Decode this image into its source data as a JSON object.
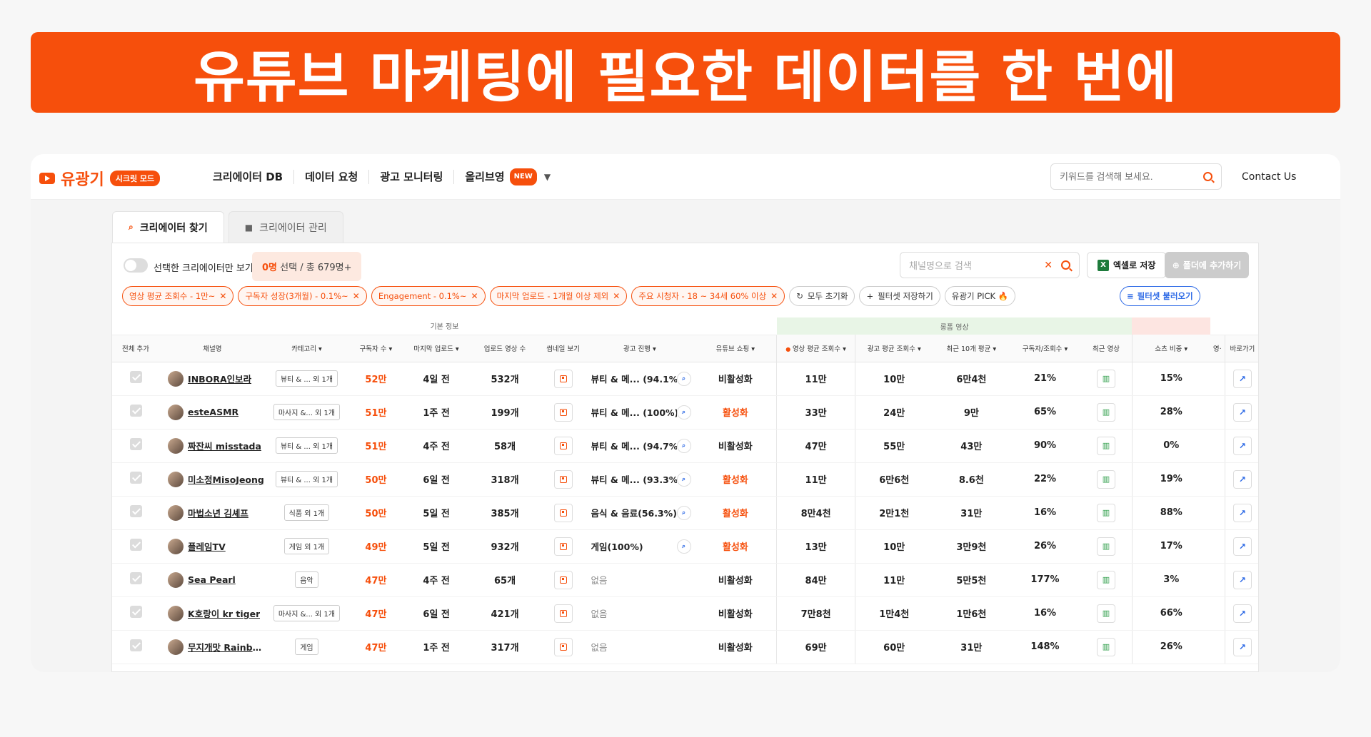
{
  "banner": {
    "title": "유튜브 마케팅에 필요한 데이터를 한 번에"
  },
  "header": {
    "logo_text": "유광기",
    "mode_badge": "시크릿 모드",
    "nav": [
      {
        "label": "크리에이터 DB"
      },
      {
        "label": "데이터 요청"
      },
      {
        "label": "광고 모니터링"
      },
      {
        "label": "올리브영",
        "badge": "NEW"
      }
    ],
    "search_placeholder": "키워드를 검색해 보세요.",
    "contact": "Contact Us"
  },
  "tabs": [
    {
      "label": "크리에이터 찾기",
      "icon": "search-icon"
    },
    {
      "label": "크리에이터 관리",
      "icon": "folder-icon"
    }
  ],
  "toolbar": {
    "only_selected_label": "선택한 크리에이터만 보기",
    "selected_count": "0명",
    "selected_suffix": "선택 / 총 679명+",
    "channel_search_placeholder": "채널명으로 검색",
    "excel_label": "엑셀로 저장",
    "folder_label": "폴더에 추가하기"
  },
  "filters": [
    "영상 평균 조회수 - 1만~",
    "구독자 성장(3개월) - 0.1%~",
    "Engagement - 0.1%~",
    "마지막 업로드 - 1개월 이상 제외",
    "주요 시청자 - 18 ~ 34세 60% 이상"
  ],
  "filter_actions": {
    "reset": "모두 초기화",
    "save": "필터셋 저장하기",
    "pick": "유광기 PICK 🔥",
    "load": "필터셋 불러오기"
  },
  "table": {
    "groups": {
      "basic": "기본 정보",
      "shorts": "롱폼 영상"
    },
    "headers": [
      "전체 추가",
      "채널명",
      "카테고리",
      "구독자 수",
      "마지막 업로드",
      "업로드 영상 수",
      "썸네일 보기",
      "광고 진행",
      "유튜브 쇼핑",
      "영상 평균 조회수",
      "광고 평균 조회수",
      "최근 10개 평균",
      "구독자/조회수",
      "최근 영상",
      "쇼츠 비중",
      "영·",
      "바로가기"
    ],
    "rows": [
      {
        "name": "INBORA인보라",
        "category": "뷰티 & ...  외 1개",
        "subs": "52만",
        "last": "4일 전",
        "videos": "532개",
        "ad": "뷰티 & 메...  (94.1%)",
        "shopping": "비활성화",
        "avg": "11만",
        "ad_avg": "10만",
        "recent10": "6만4천",
        "ratio": "21%",
        "shorts": "15%"
      },
      {
        "name": "esteASMR",
        "category": "마사지 &...  외 1개",
        "subs": "51만",
        "last": "1주 전",
        "videos": "199개",
        "ad": "뷰티 & 메...  (100%)",
        "shopping": "활성화",
        "avg": "33만",
        "ad_avg": "24만",
        "recent10": "9만",
        "ratio": "65%",
        "shorts": "28%"
      },
      {
        "name": "짜잔씨 misstada",
        "category": "뷰티 & ...  외 1개",
        "subs": "51만",
        "last": "4주 전",
        "videos": "58개",
        "ad": "뷰티 & 메...  (94.7%)",
        "shopping": "비활성화",
        "avg": "47만",
        "ad_avg": "55만",
        "recent10": "43만",
        "ratio": "90%",
        "shorts": "0%"
      },
      {
        "name": "미소정MisoJeong",
        "category": "뷰티 & ...  외 1개",
        "subs": "50만",
        "last": "6일 전",
        "videos": "318개",
        "ad": "뷰티 & 메...  (93.3%)",
        "shopping": "활성화",
        "avg": "11만",
        "ad_avg": "6만6천",
        "recent10": "8.6천",
        "ratio": "22%",
        "shorts": "19%"
      },
      {
        "name": "마법소년 김셰프",
        "category": "식품 외 1개",
        "subs": "50만",
        "last": "5일 전",
        "videos": "385개",
        "ad": "음식 & 음료(56.3%)",
        "shopping": "활성화",
        "avg": "8만4천",
        "ad_avg": "2만1천",
        "recent10": "31만",
        "ratio": "16%",
        "shorts": "88%"
      },
      {
        "name": "플레임TV",
        "category": "게임 외 1개",
        "subs": "49만",
        "last": "5일 전",
        "videos": "932개",
        "ad": "게임(100%)",
        "shopping": "활성화",
        "avg": "13만",
        "ad_avg": "10만",
        "recent10": "3만9천",
        "ratio": "26%",
        "shorts": "17%"
      },
      {
        "name": "Sea Pearl",
        "category": "음악",
        "subs": "47만",
        "last": "4주 전",
        "videos": "65개",
        "ad": "없음",
        "shopping": "비활성화",
        "avg": "84만",
        "ad_avg": "11만",
        "recent10": "5만5천",
        "ratio": "177%",
        "shorts": "3%"
      },
      {
        "name": "K호랑이 kr tiger",
        "category": "마사지 &...  외 1개",
        "subs": "47만",
        "last": "6일 전",
        "videos": "421개",
        "ad": "없음",
        "shopping": "비활성화",
        "avg": "7만8천",
        "ad_avg": "1만4천",
        "recent10": "1만6천",
        "ratio": "16%",
        "shorts": "66%"
      },
      {
        "name": "무지개맛 Rainbow...",
        "category": "게임",
        "subs": "47만",
        "last": "1주 전",
        "videos": "317개",
        "ad": "없음",
        "shopping": "비활성화",
        "avg": "69만",
        "ad_avg": "60만",
        "recent10": "31만",
        "ratio": "148%",
        "shorts": "26%"
      }
    ]
  },
  "colors": {
    "brand": "#f64f0c",
    "link": "#2f6be6",
    "chart": "#2f9e4a"
  }
}
